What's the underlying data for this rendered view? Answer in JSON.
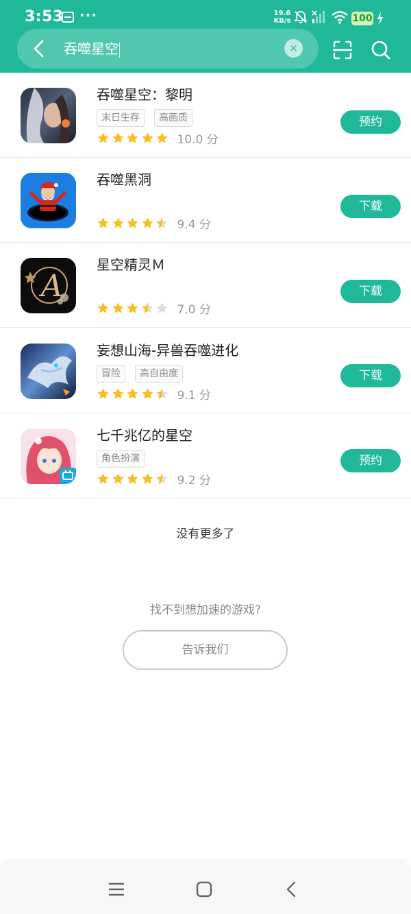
{
  "status": {
    "time": "3:53",
    "more_indicator": "···",
    "net_speed_value": "19.6",
    "net_speed_unit": "KB/s",
    "battery": "100",
    "icons": [
      "sim-card-icon",
      "bell-off-icon",
      "signal-icon",
      "wifi-icon",
      "charging-icon"
    ]
  },
  "header": {
    "query": "吞噬星空",
    "clear_glyph": "×"
  },
  "results": [
    {
      "title": "吞噬星空：黎明",
      "tags": [
        "末日生存",
        "高画质"
      ],
      "stars": [
        1,
        1,
        1,
        1,
        1
      ],
      "score": "10.0 分",
      "action": "预约"
    },
    {
      "title": "吞噬黑洞",
      "tags": [],
      "stars": [
        1,
        1,
        1,
        1,
        0.5
      ],
      "score": "9.4 分",
      "action": "下载"
    },
    {
      "title": "星空精灵Ｍ",
      "tags": [],
      "stars": [
        1,
        1,
        1,
        0.5,
        0
      ],
      "score": "7.0 分",
      "action": "下载"
    },
    {
      "title": "妄想山海-异兽吞噬进化",
      "tags": [
        "冒险",
        "高自由度"
      ],
      "stars": [
        1,
        1,
        1,
        1,
        0.5
      ],
      "score": "9.1 分",
      "action": "下载"
    },
    {
      "title": "七千兆亿的星空",
      "tags": [
        "角色扮演"
      ],
      "stars": [
        1,
        1,
        1,
        1,
        0.5
      ],
      "score": "9.2 分",
      "action": "预约"
    }
  ],
  "footer": {
    "no_more": "没有更多了",
    "cant_find": "找不到想加速的游戏?",
    "tell_us": "告诉我们"
  },
  "colors": {
    "accent": "#1fb99a",
    "star": "#fbbd1b",
    "star_empty": "#dddddd"
  }
}
